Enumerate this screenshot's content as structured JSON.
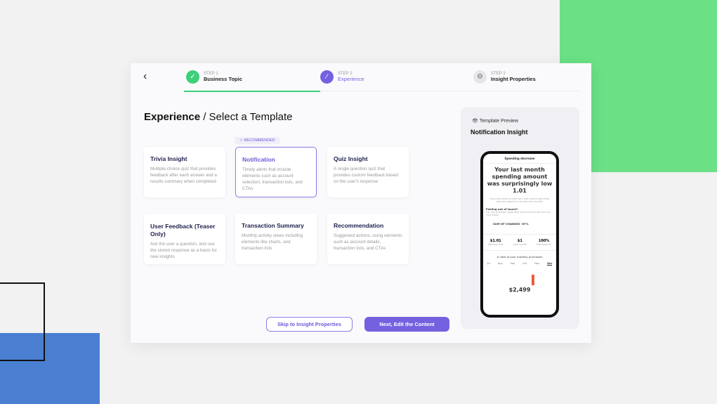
{
  "steps": [
    {
      "label": "STEP 1",
      "name": "Business Topic",
      "status": "complete"
    },
    {
      "label": "STEP 2",
      "name": "Experience",
      "status": "active"
    },
    {
      "label": "STEP 3",
      "name": "Insight Properties",
      "status": "pending"
    }
  ],
  "title": {
    "bold": "Experience",
    "rest": " / Select a Template"
  },
  "recommended": "☆ RECOMMENDED",
  "cards": [
    {
      "title": "Trivia Insight",
      "desc": "Multiple-choice quiz that provides feedback after each answer and a results summary when completed"
    },
    {
      "title": "Notification",
      "desc": "Timely alerts that include elements such as account selection, transaction lists, and CTAs",
      "selected": true
    },
    {
      "title": "Quiz Insight",
      "desc": "A single question quiz that provides custom feedback based on the user's response"
    },
    {
      "title": "User Feedback (Teaser Only)",
      "desc": "Ask the user a question, and use the stored response as a basis for new insights"
    },
    {
      "title": "Transaction Summary",
      "desc": "Monthly activity views including elements like charts, and transaction lists"
    },
    {
      "title": "Recommendation",
      "desc": "Suggested actions, using elements such as account details, transaction lists, and CTAs"
    }
  ],
  "buttons": {
    "skip": "Skip to Insight Properties",
    "next": "Next, Edit the Content"
  },
  "preview": {
    "label": "Template Preview",
    "title": "Notification Insight",
    "phone": {
      "header": "Spending decrease",
      "headline": "Your last month spending amount was surprisingly low 1.01",
      "sub": "You may want to note your last month spending was the lowest in the last few months",
      "touch": "Feeling out of touch?",
      "touch_sub": "For any question regarding your account we are one click away.",
      "sum": "SUM OF CHANGES -67%",
      "stats": [
        {
          "v": "$1.01",
          "l": "Monthly Avg"
        },
        {
          "v": "$1",
          "l": "Last month"
        },
        {
          "v": "100%",
          "l": "Decrease %"
        }
      ],
      "chart_title": "A view of your monthly purchases",
      "months": [
        "Jul",
        "Aug",
        "Sep",
        "Oct",
        "Nov",
        "Dec"
      ],
      "total": "$2,499"
    }
  },
  "colors": {
    "accent": "#7361e0",
    "success": "#3ecf7a",
    "green_bg": "#6be085",
    "blue_bg": "#4a7fd1"
  }
}
